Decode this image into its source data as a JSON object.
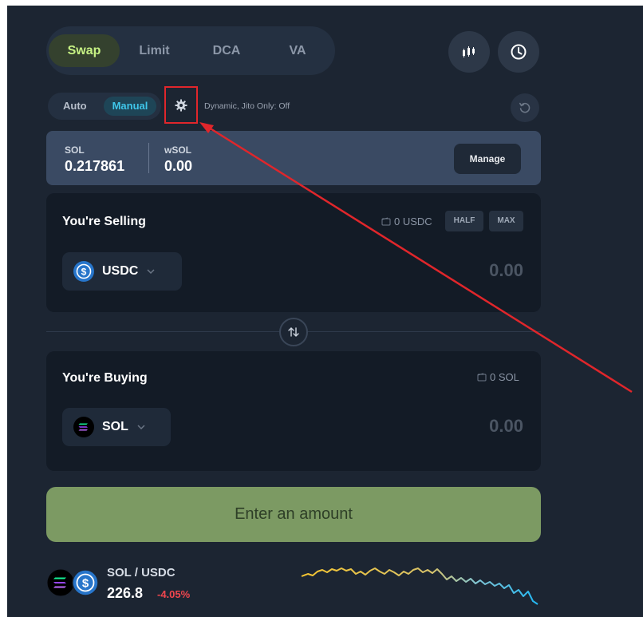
{
  "tabs": [
    {
      "label": "Swap",
      "active": true
    },
    {
      "label": "Limit",
      "active": false
    },
    {
      "label": "DCA",
      "active": false
    },
    {
      "label": "VA",
      "active": false
    }
  ],
  "mode": {
    "auto_label": "Auto",
    "manual_label": "Manual",
    "selected": "Manual",
    "description": "Dynamic, Jito Only: Off"
  },
  "balances": {
    "sol_label": "SOL",
    "sol_value": "0.217861",
    "wsol_label": "wSOL",
    "wsol_value": "0.00",
    "manage_label": "Manage"
  },
  "selling": {
    "title": "You're Selling",
    "wallet_balance": "0 USDC",
    "half_label": "HALF",
    "max_label": "MAX",
    "token": "USDC",
    "amount_placeholder": "0.00"
  },
  "buying": {
    "title": "You're Buying",
    "wallet_balance": "0 SOL",
    "token": "SOL",
    "amount_placeholder": "0.00"
  },
  "cta_label": "Enter an amount",
  "price": {
    "pair": "SOL / USDC",
    "value": "226.8",
    "change": "-4.05%"
  },
  "colors": {
    "accent_green": "#c7f284",
    "manual_blue": "#3fc6ea",
    "negative_red": "#f0464e",
    "annotation_red": "#e0262b"
  },
  "icons": {
    "chart": "candlestick-chart-icon",
    "history": "clock-icon",
    "settings": "gear-icon",
    "refresh": "refresh-icon",
    "swap": "swap-arrows-icon",
    "wallet": "wallet-icon"
  }
}
